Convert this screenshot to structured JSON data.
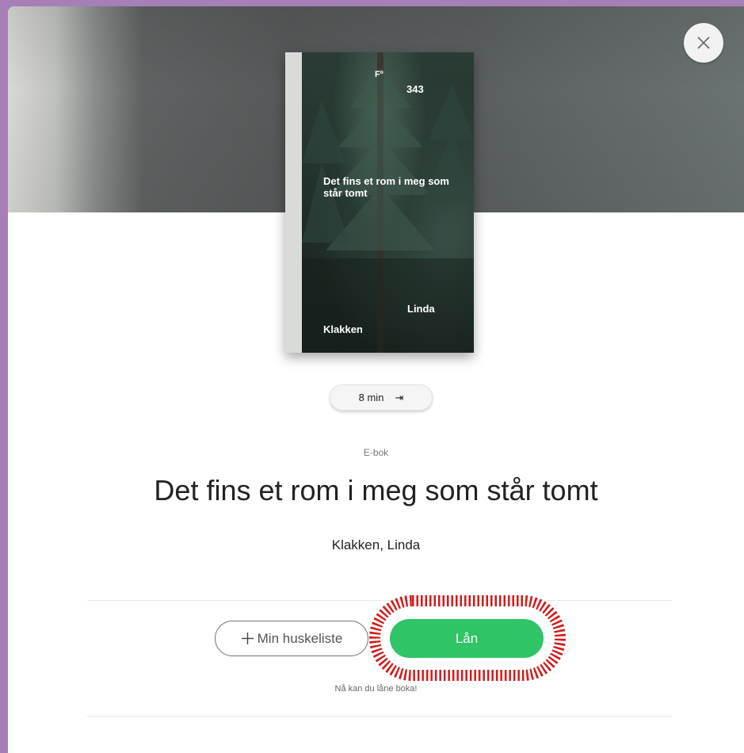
{
  "modal": {
    "close_icon": "close-icon"
  },
  "cover": {
    "publisher": "Fº",
    "code": "343",
    "title": "Det fins et rom i meg som står tomt",
    "author_first": "Linda",
    "author_last": "Klakken"
  },
  "duration": {
    "label": "8 min",
    "icon": "skip-to-end-icon",
    "glyph": "⇥"
  },
  "book": {
    "format": "E-bok",
    "title": "Det fins et rom i meg som står tomt",
    "author": "Klakken, Linda"
  },
  "actions": {
    "wishlist_icon": "plus-icon",
    "wishlist_label": "Min huskeliste",
    "borrow_label": "Lån",
    "availability_text": "Nå kan du låne boka!"
  },
  "colors": {
    "backdrop": "#a77fb8",
    "borrow_button": "#2fc466",
    "highlight_ring": "#d21a1a"
  }
}
